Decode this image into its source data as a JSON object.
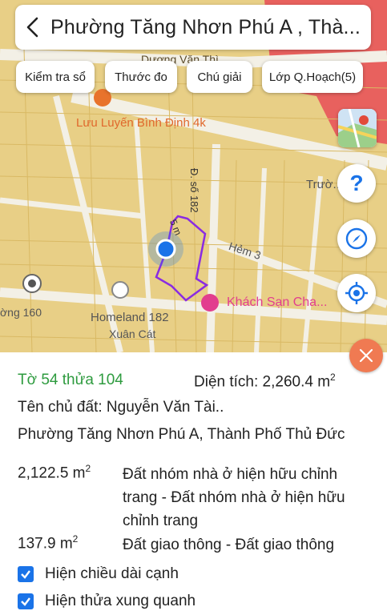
{
  "header": {
    "title": "Phường Tăng Nhơn Phú A , Thà..."
  },
  "chips": {
    "check_book": "Kiểm tra sổ",
    "ruler": "Thước đo",
    "legend": "Chú giải",
    "planning_layer": "Lớp Q.Hoạch(5)"
  },
  "map_labels": {
    "street_top": "Dương Văn Thì",
    "restaurant": "Lưu Luyến Bình Định 4k",
    "road_182": "Đ. số 182",
    "hem": "Hẻm 3",
    "hotel": "Khách Sạn Cha...",
    "homeland": "Homeland 182",
    "xuan_cat": "Xuân Cát",
    "duong_160": "ờng 160",
    "truong": "Trườ...",
    "dimension": "5 m"
  },
  "parcel": {
    "id_text": "Tờ 54 thửa 104",
    "area_label": "Diện tích: 2,260.4 m",
    "area_sup": "2",
    "owner": "Tên chủ đất: Nguyễn Văn Tài..",
    "address": "Phường Tăng Nhơn Phú A, Thành Phố Thủ Đức",
    "uses": [
      {
        "area": "2,122.5 m",
        "sup": "2",
        "desc": "Đất nhóm nhà ở hiện hữu chỉnh trang - Đất nhóm nhà ở hiện hữu chỉnh trang"
      },
      {
        "area": "137.9 m",
        "sup": "2",
        "desc": "Đất giao thông - Đất giao thông"
      }
    ]
  },
  "options": {
    "show_edge_length": "Hiện chiều dài cạnh",
    "show_neighbor_parcels": "Hiện thửa xung quanh"
  },
  "colors": {
    "parcel_green": "#2e9b3f",
    "checkbox_blue": "#1a73e8",
    "close_orange": "#f07a52",
    "parcel_outline": "#8a2be2",
    "map_residential": "#e8cf86",
    "map_commercial": "#e8615e"
  }
}
